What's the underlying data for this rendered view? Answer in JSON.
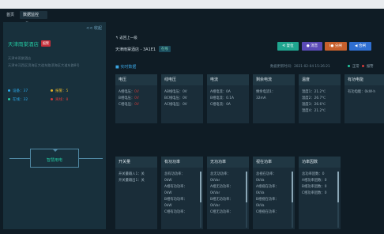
{
  "tabs": {
    "home": "首页",
    "monitor": "数据监控"
  },
  "left": {
    "collapse": "<< 收起",
    "hotel": "天津雨棠酒店",
    "badge": "报警",
    "addr_line1": "天津市雨棠酒店",
    "addr_line2": "天津市河西区滨海区大道东路滨海区大道东路8号",
    "stats": [
      {
        "label": "设备：",
        "value": "37",
        "color": "#2aa7e8"
      },
      {
        "label": "报警：",
        "value": "5",
        "color": "#e0b12a"
      },
      {
        "label": "在线：",
        "value": "32",
        "color": "#23c6a0"
      },
      {
        "label": "离线：",
        "value": "8",
        "color": "#d23a3a"
      }
    ],
    "manager": "智慧用电"
  },
  "main": {
    "back": "返回上一级",
    "hotel": "天津雨棠酒店 - 3A1E1",
    "online": "在线",
    "buttons": {
      "reset": "复位",
      "shield": "消音",
      "split": "分闸",
      "close": "合闸"
    },
    "realtime": "实时数据",
    "update": "数据更新时间：2021-02-04 15:26:21",
    "legend_normal": "正常",
    "legend_alarm": "报警"
  },
  "panels_top": [
    {
      "title": "电压",
      "lines": [
        {
          "k": "A相电压：",
          "v": "0V",
          "red": true
        },
        {
          "k": "B相电压：",
          "v": "0V",
          "red": true
        },
        {
          "k": "C相电压：",
          "v": "0V",
          "red": true
        }
      ]
    },
    {
      "title": "线电压",
      "lines": [
        {
          "k": "AB线电压：",
          "v": "0V"
        },
        {
          "k": "BC线电压：",
          "v": "0V"
        },
        {
          "k": "AC线电压：",
          "v": "0V"
        }
      ]
    },
    {
      "title": "电流",
      "lines": [
        {
          "k": "A相电流：",
          "v": "0A"
        },
        {
          "k": "B相电流：",
          "v": "0.1A"
        },
        {
          "k": "C相电流：",
          "v": "0A"
        }
      ]
    },
    {
      "title": "剩余电流",
      "lines": [
        {
          "k": "剩余电流1：",
          "v": ""
        },
        {
          "k": "",
          "v": "32mA"
        }
      ]
    },
    {
      "title": "温度",
      "lines": [
        {
          "k": "温度1：",
          "v": "21.2℃"
        },
        {
          "k": "温度2：",
          "v": "26.7℃"
        },
        {
          "k": "温度3：",
          "v": "26.6℃"
        },
        {
          "k": "温度4：",
          "v": "21.2℃"
        }
      ]
    },
    {
      "title": "有功电能",
      "lines": [
        {
          "k": "有功电能：",
          "v": "0kW·h"
        }
      ]
    }
  ],
  "panels_bottom": [
    {
      "title": "开关量",
      "lines": [
        {
          "k": "开关量输入1：",
          "v": "关"
        },
        {
          "k": "开关量输出1：",
          "v": "关"
        }
      ]
    },
    {
      "title": "有功功率",
      "lines": [
        {
          "k": "总有功功率：",
          "v": ""
        },
        {
          "k": "",
          "v": "0kW"
        },
        {
          "k": "A相有功功率：",
          "v": ""
        },
        {
          "k": "",
          "v": "0kW"
        },
        {
          "k": "B相有功功率：",
          "v": ""
        },
        {
          "k": "",
          "v": "0kW"
        },
        {
          "k": "C相有功功率：",
          "v": ""
        }
      ]
    },
    {
      "title": "无功功率",
      "lines": [
        {
          "k": "总无功功率：",
          "v": ""
        },
        {
          "k": "",
          "v": "0kVar"
        },
        {
          "k": "A相无功功率：",
          "v": ""
        },
        {
          "k": "",
          "v": "0kVar"
        },
        {
          "k": "B相无功功率：",
          "v": ""
        },
        {
          "k": "",
          "v": "0kVar"
        },
        {
          "k": "C相无功功率：",
          "v": ""
        }
      ]
    },
    {
      "title": "视在功率",
      "lines": [
        {
          "k": "总视在功率：",
          "v": ""
        },
        {
          "k": "",
          "v": "0kVa"
        },
        {
          "k": "A相视在功率：",
          "v": ""
        },
        {
          "k": "",
          "v": "0kVa"
        },
        {
          "k": "B相视在功率：",
          "v": ""
        },
        {
          "k": "",
          "v": "0kVa"
        },
        {
          "k": "C相视在功率：",
          "v": ""
        }
      ]
    },
    {
      "title": "功率因数",
      "lines": [
        {
          "k": "总功率因数：",
          "v": "0"
        },
        {
          "k": "A相功率因数：",
          "v": "0"
        },
        {
          "k": "B相功率因数：",
          "v": "0"
        },
        {
          "k": "C相功率因数：",
          "v": "0"
        }
      ]
    }
  ]
}
